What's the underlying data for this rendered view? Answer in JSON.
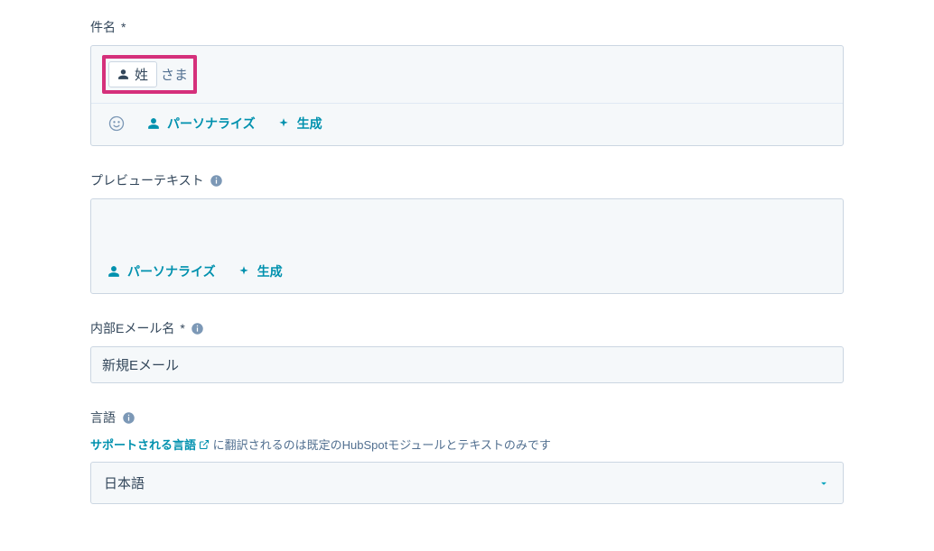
{
  "subject": {
    "label": "件名",
    "required": "*",
    "token_label": "姓",
    "suffix_text": "さま",
    "toolbar": {
      "personalize": "パーソナライズ",
      "generate": "生成"
    }
  },
  "preview": {
    "label": "プレビューテキスト",
    "toolbar": {
      "personalize": "パーソナライズ",
      "generate": "生成"
    }
  },
  "internal_name": {
    "label": "内部Eメール名",
    "required": "*",
    "value": "新規Eメール"
  },
  "language": {
    "label": "言語",
    "help_link": "サポートされる言語",
    "help_text": "に翻訳されるのは既定のHubSpotモジュールとテキストのみです",
    "selected": "日本語"
  }
}
